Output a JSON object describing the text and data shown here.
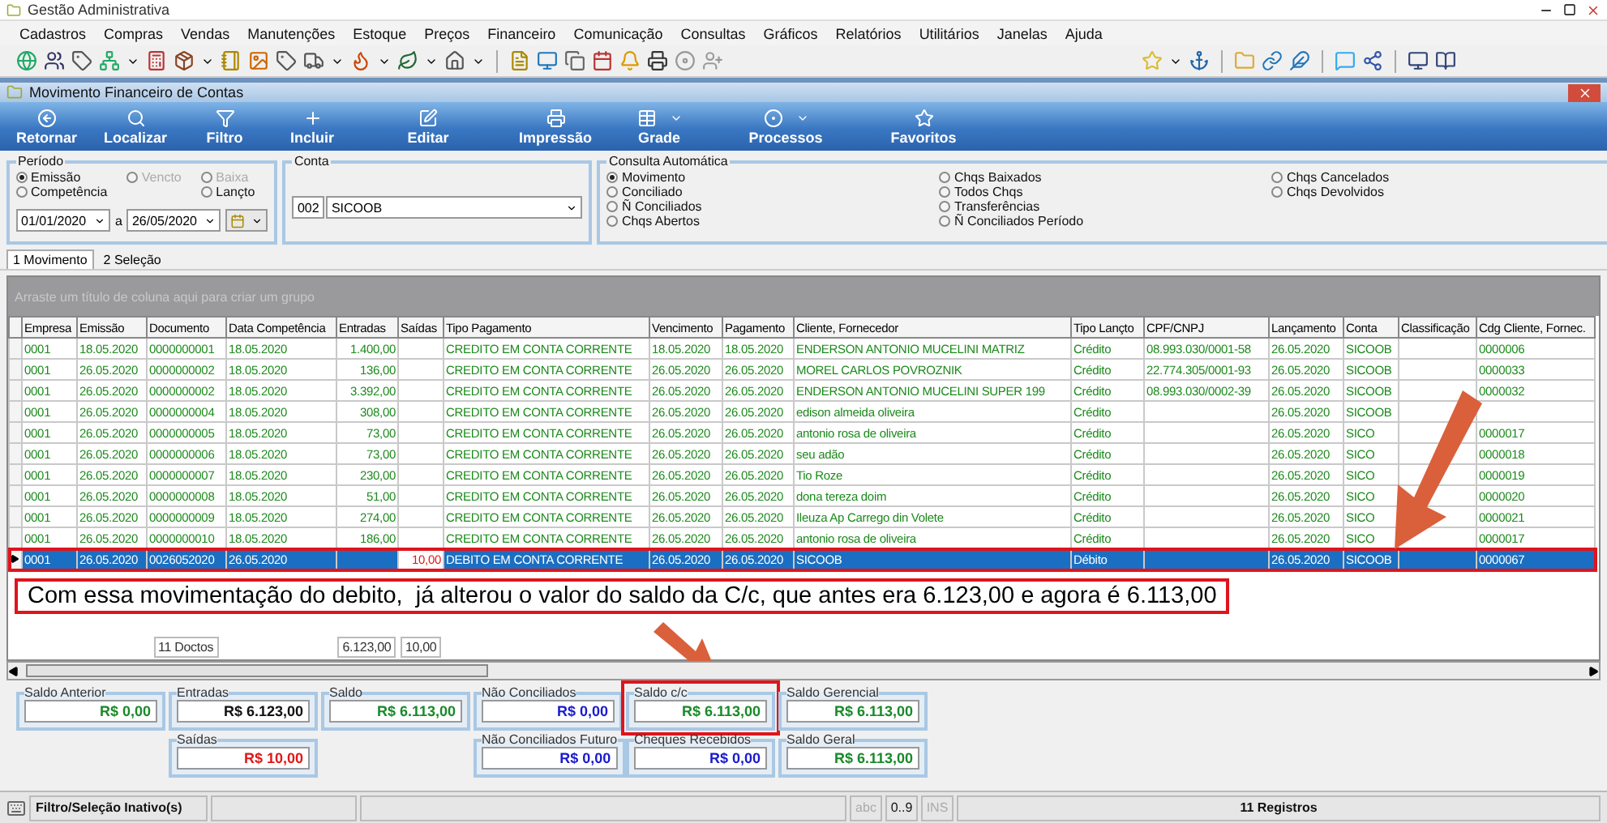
{
  "app": {
    "title": "Gestão Administrativa"
  },
  "menu": [
    "Cadastros",
    "Compras",
    "Vendas",
    "Manutenções",
    "Estoque",
    "Preços",
    "Financeiro",
    "Comunicação",
    "Consultas",
    "Gráficos",
    "Relatórios",
    "Utilitários",
    "Janelas",
    "Ajuda"
  ],
  "window": {
    "title": "Movimento Financeiro de Contas"
  },
  "actions": [
    {
      "label": "Retornar",
      "has_menu": false
    },
    {
      "label": "Localizar",
      "has_menu": false
    },
    {
      "label": "Filtro",
      "has_menu": false
    },
    {
      "label": "Incluir",
      "has_menu": false
    },
    {
      "label": "Editar",
      "has_menu": false
    },
    {
      "label": "Impressão",
      "has_menu": false
    },
    {
      "label": "Grade",
      "has_menu": true
    },
    {
      "label": "Processos",
      "has_menu": true
    },
    {
      "label": "Favoritos",
      "has_menu": false
    }
  ],
  "periodo": {
    "legend": "Período",
    "options": [
      {
        "label": "Emissão",
        "selected": true,
        "disabled": false
      },
      {
        "label": "Vencto",
        "selected": false,
        "disabled": true
      },
      {
        "label": "Baixa",
        "selected": false,
        "disabled": true
      },
      {
        "label": "Competência",
        "selected": false,
        "disabled": false
      },
      {
        "label": "Lançto",
        "selected": false,
        "disabled": false
      }
    ],
    "date_from": "01/01/2020",
    "separator": "a",
    "date_to": "26/05/2020"
  },
  "conta": {
    "legend": "Conta",
    "code": "002",
    "name": "SICOOB"
  },
  "consulta": {
    "legend": "Consulta Automática",
    "options": [
      {
        "label": "Movimento",
        "selected": true
      },
      {
        "label": "Conciliado",
        "selected": false
      },
      {
        "label": "Ñ Conciliados",
        "selected": false
      },
      {
        "label": "Chqs Abertos",
        "selected": false
      },
      {
        "label": "Chqs Baixados",
        "selected": false
      },
      {
        "label": "Todos Chqs",
        "selected": false
      },
      {
        "label": "Transferências",
        "selected": false
      },
      {
        "label": "Ñ Conciliados Período",
        "selected": false
      },
      {
        "label": "Chqs Cancelados",
        "selected": false
      },
      {
        "label": "Chqs Devolvidos",
        "selected": false
      }
    ]
  },
  "tabs": [
    {
      "label": "1 Movimento",
      "selected": true
    },
    {
      "label": "2 Seleção",
      "selected": false
    }
  ],
  "grid": {
    "group_hint": "Arraste um título de coluna aqui para criar um grupo",
    "columns": [
      "Empresa",
      "Emissão",
      "Documento",
      "Data Competência",
      "Entradas",
      "Saídas",
      "Tipo Pagamento",
      "Vencimento",
      "Pagamento",
      "Cliente, Fornecedor",
      "Tipo Lançto",
      "CPF/CNPJ",
      "Lançamento",
      "Conta",
      "Classificação",
      "Cdg Cliente, Fornec."
    ],
    "rows": [
      {
        "kind": "credito",
        "selected": false,
        "annotated": false,
        "empresa": "0001",
        "emissao": "18.05.2020",
        "documento": "0000000001",
        "competencia": "18.05.2020",
        "entradas": "1.400,00",
        "tipo_pagamento": "CREDITO EM CONTA CORRENTE",
        "vencimento": "18.05.2020",
        "pagamento": "18.05.2020",
        "cliente": "ENDERSON ANTONIO MUCELINI MATRIZ",
        "tipo_lancto": "Crédito",
        "cpf_cnpj": "08.993.030/0001-58",
        "lancamento": "26.05.2020",
        "conta": "SICOOB",
        "cdg": "0000006"
      },
      {
        "kind": "credito",
        "selected": false,
        "annotated": false,
        "empresa": "0001",
        "emissao": "26.05.2020",
        "documento": "0000000002",
        "competencia": "18.05.2020",
        "entradas": "136,00",
        "tipo_pagamento": "CREDITO EM CONTA CORRENTE",
        "vencimento": "26.05.2020",
        "pagamento": "26.05.2020",
        "cliente": "MOREL CARLOS POVROZNIK",
        "tipo_lancto": "Crédito",
        "cpf_cnpj": "22.774.305/0001-93",
        "lancamento": "26.05.2020",
        "conta": "SICOOB",
        "cdg": "0000033"
      },
      {
        "kind": "credito",
        "selected": false,
        "annotated": false,
        "empresa": "0001",
        "emissao": "26.05.2020",
        "documento": "0000000002",
        "competencia": "18.05.2020",
        "entradas": "3.392,00",
        "tipo_pagamento": "CREDITO EM CONTA CORRENTE",
        "vencimento": "26.05.2020",
        "pagamento": "26.05.2020",
        "cliente": "ENDERSON ANTONIO MUCELINI SUPER 199",
        "tipo_lancto": "Crédito",
        "cpf_cnpj": "08.993.030/0002-39",
        "lancamento": "26.05.2020",
        "conta": "SICOOB",
        "cdg": "0000032"
      },
      {
        "kind": "credito",
        "selected": false,
        "annotated": false,
        "empresa": "0001",
        "emissao": "26.05.2020",
        "documento": "0000000004",
        "competencia": "18.05.2020",
        "entradas": "308,00",
        "tipo_pagamento": "CREDITO EM CONTA CORRENTE",
        "vencimento": "26.05.2020",
        "pagamento": "26.05.2020",
        "cliente": "edison almeida oliveira",
        "tipo_lancto": "Crédito",
        "lancamento": "26.05.2020",
        "conta": "SICOOB"
      },
      {
        "kind": "credito",
        "selected": false,
        "annotated": false,
        "empresa": "0001",
        "emissao": "26.05.2020",
        "documento": "0000000005",
        "competencia": "18.05.2020",
        "entradas": "73,00",
        "tipo_pagamento": "CREDITO EM CONTA CORRENTE",
        "vencimento": "26.05.2020",
        "pagamento": "26.05.2020",
        "cliente": "antonio rosa de oliveira",
        "tipo_lancto": "Crédito",
        "lancamento": "26.05.2020",
        "conta": "SICO",
        "cdg": "0000017"
      },
      {
        "kind": "credito",
        "selected": false,
        "annotated": false,
        "empresa": "0001",
        "emissao": "26.05.2020",
        "documento": "0000000006",
        "competencia": "18.05.2020",
        "entradas": "73,00",
        "tipo_pagamento": "CREDITO EM CONTA CORRENTE",
        "vencimento": "26.05.2020",
        "pagamento": "26.05.2020",
        "cliente": "seu adão",
        "tipo_lancto": "Crédito",
        "lancamento": "26.05.2020",
        "conta": "SICO",
        "cdg": "0000018"
      },
      {
        "kind": "credito",
        "selected": false,
        "annotated": false,
        "empresa": "0001",
        "emissao": "26.05.2020",
        "documento": "0000000007",
        "competencia": "18.05.2020",
        "entradas": "230,00",
        "tipo_pagamento": "CREDITO EM CONTA CORRENTE",
        "vencimento": "26.05.2020",
        "pagamento": "26.05.2020",
        "cliente": "Tio Roze",
        "tipo_lancto": "Crédito",
        "lancamento": "26.05.2020",
        "conta": "SICO",
        "cdg": "0000019"
      },
      {
        "kind": "credito",
        "selected": false,
        "annotated": false,
        "empresa": "0001",
        "emissao": "26.05.2020",
        "documento": "0000000008",
        "competencia": "18.05.2020",
        "entradas": "51,00",
        "tipo_pagamento": "CREDITO EM CONTA CORRENTE",
        "vencimento": "26.05.2020",
        "pagamento": "26.05.2020",
        "cliente": "dona tereza doim",
        "tipo_lancto": "Crédito",
        "lancamento": "26.05.2020",
        "conta": "SICO",
        "cdg": "0000020"
      },
      {
        "kind": "credito",
        "selected": false,
        "annotated": false,
        "empresa": "0001",
        "emissao": "26.05.2020",
        "documento": "0000000009",
        "competencia": "18.05.2020",
        "entradas": "274,00",
        "tipo_pagamento": "CREDITO EM CONTA CORRENTE",
        "vencimento": "26.05.2020",
        "pagamento": "26.05.2020",
        "cliente": "Ileuza Ap Carrego din Volete",
        "tipo_lancto": "Crédito",
        "lancamento": "26.05.2020",
        "conta": "SICO",
        "cdg": "0000021"
      },
      {
        "kind": "credito",
        "selected": false,
        "annotated": false,
        "empresa": "0001",
        "emissao": "26.05.2020",
        "documento": "0000000010",
        "competencia": "18.05.2020",
        "entradas": "186,00",
        "tipo_pagamento": "CREDITO EM CONTA CORRENTE",
        "vencimento": "26.05.2020",
        "pagamento": "26.05.2020",
        "cliente": "antonio rosa de oliveira",
        "tipo_lancto": "Crédito",
        "lancamento": "26.05.2020",
        "conta": "SICO",
        "cdg": "0000017"
      },
      {
        "kind": "debito",
        "selected": true,
        "annotated": true,
        "empresa": "0001",
        "emissao": "26.05.2020",
        "documento": "0026052020",
        "competencia": "26.05.2020",
        "saidas": "10,00",
        "tipo_pagamento": "DEBITO EM CONTA CORRENTE",
        "vencimento": "26.05.2020",
        "pagamento": "26.05.2020",
        "cliente": "SICOOB",
        "tipo_lancto": "Débito",
        "lancamento": "26.05.2020",
        "conta": "SICOOB",
        "cdg": "0000067"
      }
    ],
    "footer": [
      "11 Doctos",
      "6.123,00",
      "10,00"
    ]
  },
  "annotation": {
    "text": "Com essa movimentação do debito,  já alterou o valor do saldo da C/c, que antes era 6.123,00 e agora é 6.113,00"
  },
  "summary": {
    "row_1": [
      {
        "label": "Saldo Anterior",
        "value": "R$ 0,00",
        "color": "#1a8a2a",
        "annotated": false
      },
      {
        "label": "Entradas",
        "value": "R$ 6.123,00",
        "color": "#111111",
        "annotated": false
      },
      {
        "label": "Saldo",
        "value": "R$ 6.113,00",
        "color": "#1a8a2a",
        "annotated": false
      },
      {
        "label": "Não Conciliados",
        "value": "R$ 0,00",
        "color": "#1a1ad0",
        "annotated": false
      },
      {
        "label": "Saldo c/c",
        "value": "R$ 6.113,00",
        "color": "#1a8a2a",
        "annotated": true
      },
      {
        "label": "Saldo Gerencial",
        "value": "R$ 6.113,00",
        "color": "#1a8a2a",
        "annotated": false
      }
    ],
    "row_2": [
      {
        "label": "Saídas",
        "value": "R$ 10,00",
        "color": "#e01818",
        "annotated": false
      },
      {
        "label": "Não Conciliados Futuro",
        "value": "R$ 0,00",
        "color": "#1a1ad0",
        "annotated": false
      },
      {
        "label": "Cheques Recebidos",
        "value": "R$ 0,00",
        "color": "#1a1ad0",
        "annotated": false
      },
      {
        "label": "Saldo Geral",
        "value": "R$ 6.113,00",
        "color": "#1a8a2a",
        "annotated": false
      }
    ]
  },
  "status_bar": {
    "filter": "Filtro/Seleção Inativo(s)",
    "indicators": [
      {
        "label": "abc",
        "active": false
      },
      {
        "label": "0..9",
        "active": true
      },
      {
        "label": "INS",
        "active": false
      }
    ],
    "records": "11 Registros"
  }
}
